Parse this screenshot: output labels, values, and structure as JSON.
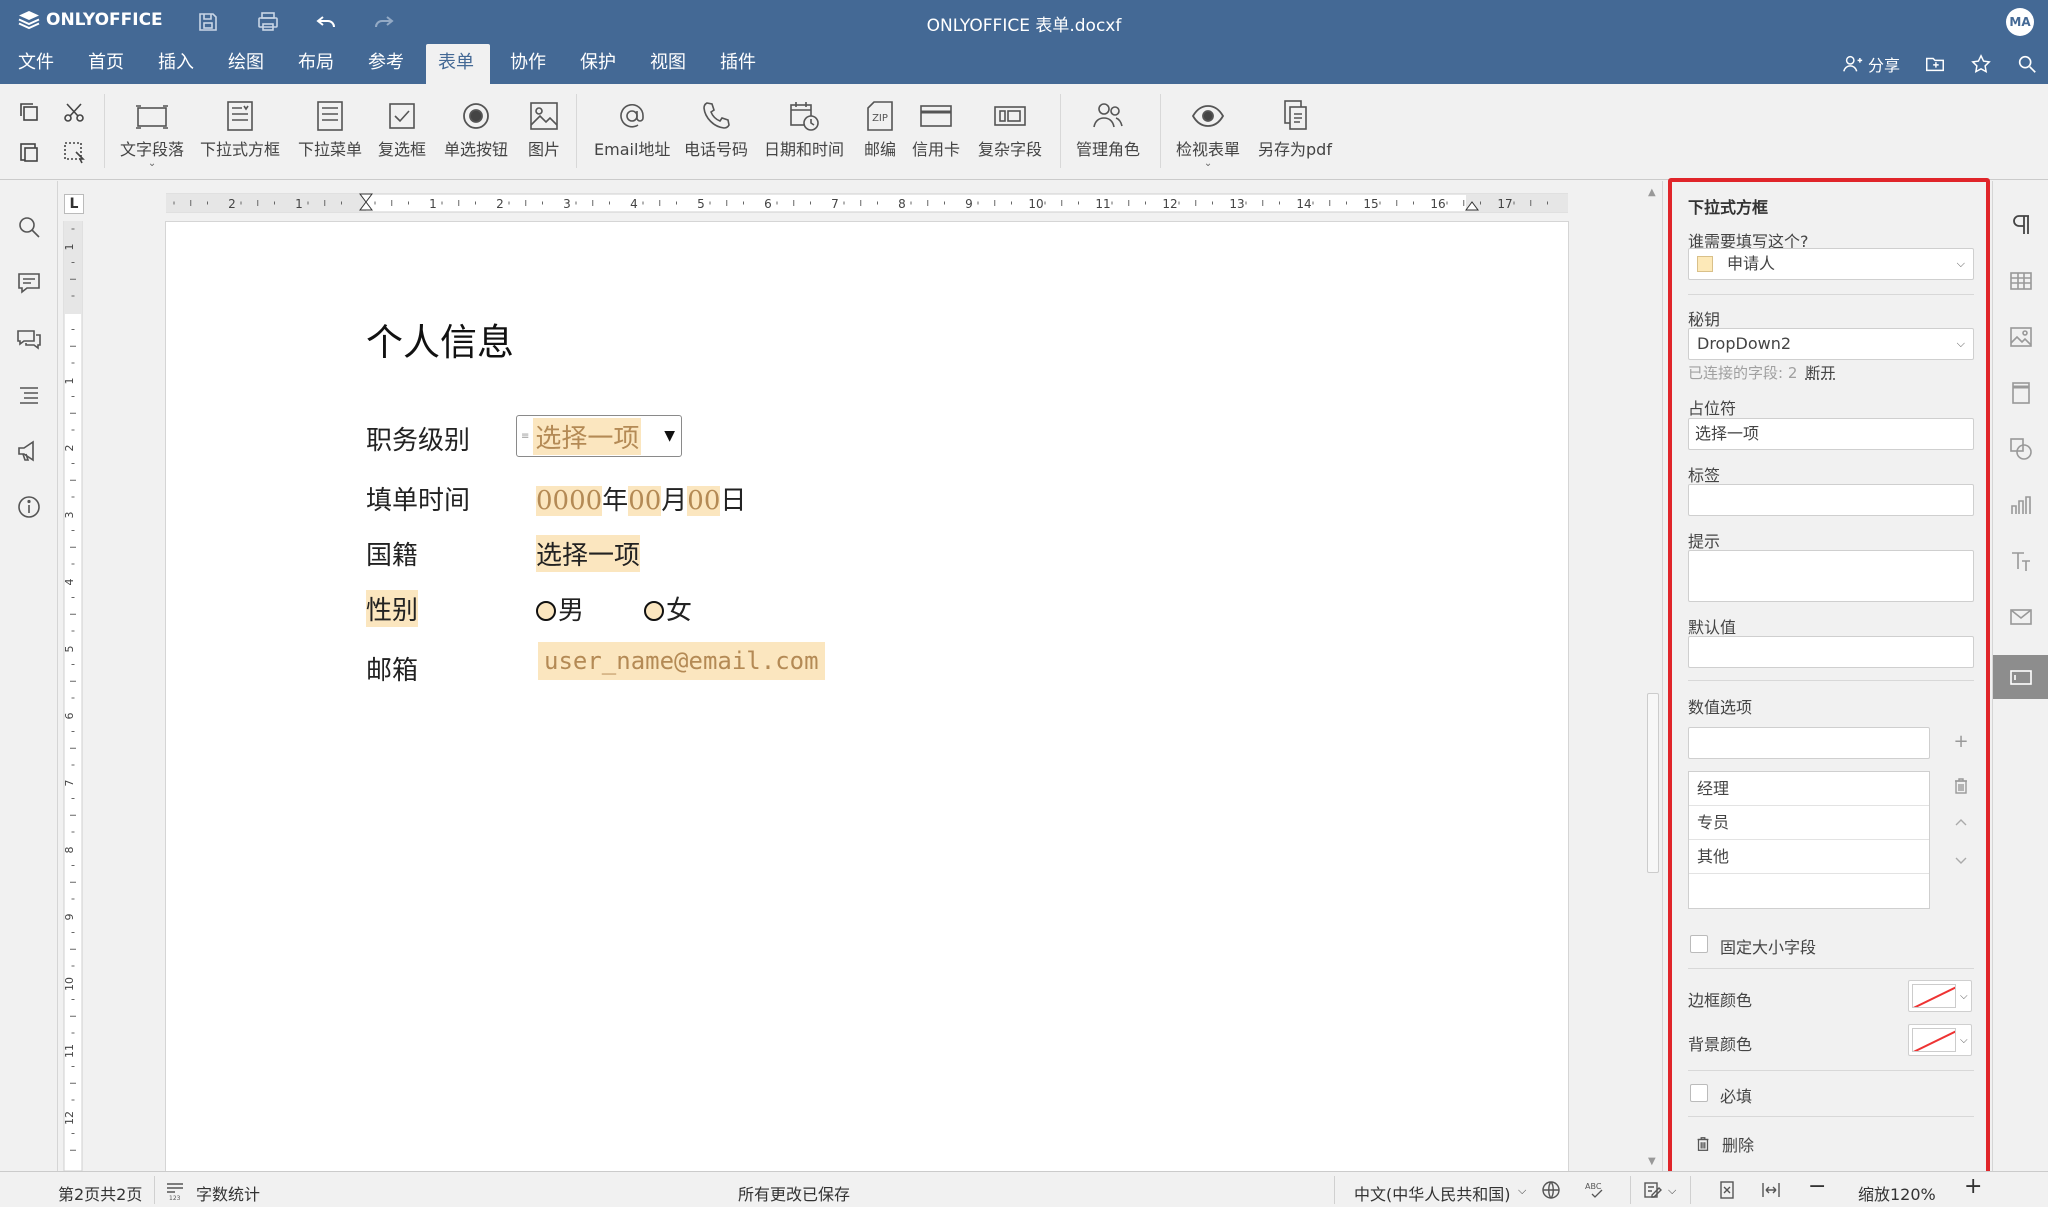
{
  "app": {
    "logo_text": "ONLYOFFICE",
    "doc_title": "ONLYOFFICE 表单.docxf",
    "avatar": "MA"
  },
  "menu": {
    "tabs": [
      "文件",
      "首页",
      "插入",
      "绘图",
      "布局",
      "参考",
      "表单",
      "协作",
      "保护",
      "视图",
      "插件"
    ],
    "active_index": 6,
    "share_label": "分享"
  },
  "toolbar": {
    "tools": [
      "文字段落",
      "下拉式方框",
      "下拉菜单",
      "复选框",
      "单选按钮",
      "图片",
      "Email地址",
      "电话号码",
      "日期和时间",
      "邮编",
      "信用卡",
      "复杂字段",
      "管理角色",
      "检视表單",
      "另存为pdf"
    ]
  },
  "ruler": {
    "h_numbers": [
      "2",
      "1",
      "1",
      "2",
      "3",
      "4",
      "5",
      "6",
      "7",
      "8",
      "9",
      "10",
      "11",
      "12",
      "13",
      "14",
      "15",
      "16",
      "17"
    ],
    "v_numbers": [
      "1",
      "1",
      "2",
      "3",
      "4",
      "5",
      "6",
      "7",
      "8",
      "9",
      "10",
      "11",
      "12"
    ],
    "corner": "L"
  },
  "document": {
    "heading": "个人信息",
    "rows": {
      "level_label": "职务级别",
      "level_placeholder": "选择一项",
      "date_label": "填单时间",
      "date_year": "0000",
      "date_year_unit": "年",
      "date_month": "00",
      "date_month_unit": "月",
      "date_day": "00",
      "date_day_unit": "日",
      "nation_label": "国籍",
      "nation_placeholder": "选择一项",
      "gender_label": "性别",
      "gender_male": "男",
      "gender_female": "女",
      "email_label": "邮箱",
      "email_placeholder": "user_name@email.com"
    }
  },
  "panel": {
    "title": "下拉式方框",
    "who_label": "谁需要填写这个?",
    "who_value": "申请人",
    "key_label": "秘钥",
    "key_value": "DropDown2",
    "connected_text": "已连接的字段: 2",
    "disconnect_label": "断开",
    "placeholder_label": "占位符",
    "placeholder_value": "选择一项",
    "tag_label": "标签",
    "hint_label": "提示",
    "default_label": "默认值",
    "options_label": "数值选项",
    "options": [
      "经理",
      "专员",
      "其他"
    ],
    "fixed_size_label": "固定大小字段",
    "border_color_label": "边框颜色",
    "bg_color_label": "背景颜色",
    "required_label": "必填",
    "delete_label": "删除"
  },
  "status": {
    "page_info": "第2页共2页",
    "word_count": "字数统计",
    "save_status": "所有更改已保存",
    "language": "中文(中华人民共和国)",
    "zoom": "缩放120%"
  },
  "colors": {
    "brand": "#446995",
    "field_highlight": "#fbe6bf",
    "selection_border": "#e0252a"
  }
}
